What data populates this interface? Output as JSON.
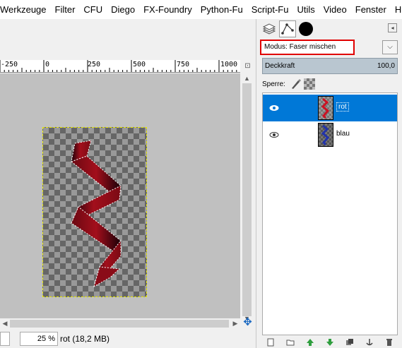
{
  "menubar": {
    "items": [
      "Werkzeuge",
      "Filter",
      "CFU",
      "Diego",
      "FX-Foundry",
      "Python-Fu",
      "Script-Fu",
      "Utils",
      "Video",
      "Fenster",
      "Hilfe"
    ]
  },
  "ruler": {
    "labels": [
      "-250",
      "0",
      "250",
      "500",
      "750",
      "1000"
    ]
  },
  "statusbar": {
    "zoom": "25 %",
    "info": "rot (18,2 MB)"
  },
  "dock": {
    "mode_label": "Modus: Faser mischen",
    "opacity_label": "Deckkraft",
    "opacity_value": "100,0",
    "lock_label": "Sperre:",
    "layers": [
      {
        "name": "rot",
        "selected": true,
        "visible": true,
        "ribbon_color": "#cc1122"
      },
      {
        "name": "blau",
        "selected": false,
        "visible": true,
        "ribbon_color": "#2233aa"
      }
    ]
  },
  "colors": {
    "selection": "#0078d7",
    "mode_highlight": "#e00000",
    "ribbon": "#a30f1c"
  }
}
